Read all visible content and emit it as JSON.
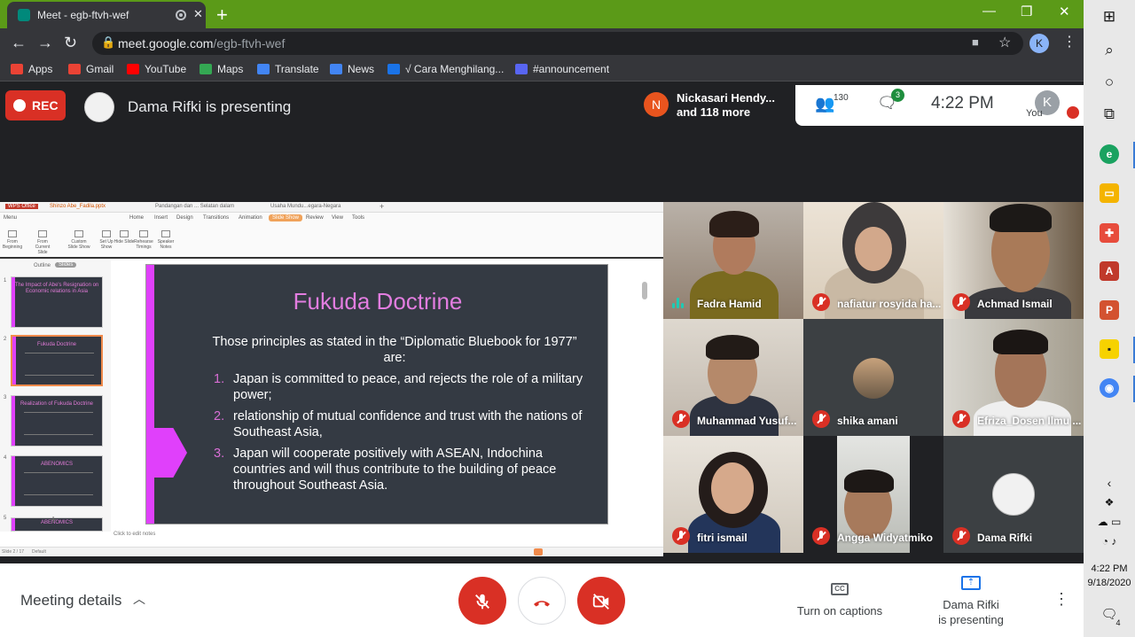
{
  "browser": {
    "tab_title": "Meet - egb-ftvh-wef",
    "tab_close": "✕",
    "new_tab": "+",
    "url_domain": "meet.google.com",
    "url_path": "/egb-ftvh-wef",
    "profile_initial": "K",
    "window_controls": [
      "—",
      "❐",
      "✕"
    ],
    "bookmarks": [
      {
        "label": "Apps",
        "color": "#ea4335"
      },
      {
        "label": "Gmail",
        "color": "#ea4335"
      },
      {
        "label": "YouTube",
        "color": "#ff0000"
      },
      {
        "label": "Maps",
        "color": "#34a853"
      },
      {
        "label": "Translate",
        "color": "#4285f4"
      },
      {
        "label": "News",
        "color": "#4285f4"
      },
      {
        "label": "√ Cara Menghilang...",
        "color": "#1a73e8"
      },
      {
        "label": "#announcement",
        "color": "#5865f2"
      }
    ]
  },
  "meet": {
    "rec_label": "REC",
    "presenting_text": "Dama Rifki is presenting",
    "notification": {
      "initial": "N",
      "line1": "Nickasari Hendy...",
      "line2": "and 118 more"
    },
    "people_count": "130",
    "chat_badge": "3",
    "clock": "4:22 PM",
    "self_label": "You",
    "self_initial": "K"
  },
  "presentation": {
    "wps_tabs": [
      "WPS Office",
      "Shinzo Abe_Fadila.pptx",
      "Pandangan dan ... Selatan dalam",
      "Usaha Mundu...egara-Negara",
      "+"
    ],
    "menu_items": [
      "Menu",
      "Home",
      "Insert",
      "Design",
      "Transitions",
      "Animation",
      "Slide Show",
      "Review",
      "View",
      "Tools"
    ],
    "ribbon_items": [
      "From Beginning",
      "From Current Slide",
      "Custom Slide Show",
      "Set Up Show",
      "Hide Slide",
      "Rehearse Timings",
      "Speaker Notes"
    ],
    "thumb_tabs": [
      "Outline",
      "Slides"
    ],
    "thumb_titles": [
      "The Impact of Abe's Resignation on Economic relations in Asia",
      "Fukuda Doctrine",
      "Realization of Fukuda Doctrine",
      "ABENOMICS",
      "ABENOMICS"
    ],
    "slide": {
      "title": "Fukuda Doctrine",
      "intro": "Those principles as stated in the “Diplomatic Bluebook for 1977” are:",
      "items": [
        {
          "num": "1.",
          "text": "Japan is committed to peace, and rejects the role of a military power;"
        },
        {
          "num": "2.",
          "text": "relationship of mutual confidence and trust with the nations of Southeast Asia,"
        },
        {
          "num": "3.",
          "text": "Japan will cooperate positively with ASEAN, Indochina countries and will thus contribute to the building of peace throughout Southeast Asia."
        }
      ]
    },
    "notes_placeholder": "Click to edit notes",
    "status_left": "Slide 2 / 17",
    "status_theme": "Default"
  },
  "participants": [
    {
      "name": "Fadra Hamid",
      "muted": false
    },
    {
      "name": "nafiatur rosyida ha...",
      "muted": true
    },
    {
      "name": "Achmad Ismail",
      "muted": true
    },
    {
      "name": "Muhammad Yusuf...",
      "muted": true
    },
    {
      "name": "shika amani",
      "muted": true
    },
    {
      "name": "Efriza_Dosen Ilmu ...",
      "muted": true
    },
    {
      "name": "fitri ismail",
      "muted": true
    },
    {
      "name": "Angga Widyatmiko",
      "muted": true
    },
    {
      "name": "Dama Rifki",
      "muted": true
    }
  ],
  "bottom_bar": {
    "meeting_details": "Meeting details",
    "captions_icon": "CC",
    "captions_label": "Turn on captions",
    "presenting_line1": "Dama Rifki",
    "presenting_line2": "is presenting"
  },
  "taskbar": {
    "time": "4:22 PM",
    "date": "9/18/2020",
    "notification_count": "4"
  }
}
